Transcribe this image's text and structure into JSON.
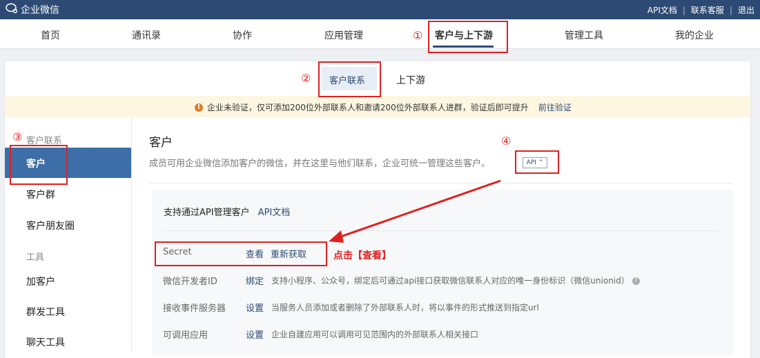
{
  "topbar": {
    "brand": "企业微信",
    "links": [
      "API文档",
      "联系客服",
      "退出"
    ]
  },
  "nav": {
    "items": [
      "首页",
      "通讯录",
      "协作",
      "应用管理",
      "客户与上下游",
      "管理工具",
      "我的企业"
    ],
    "active": "客户与上下游"
  },
  "subtabs": {
    "items": [
      "客户联系",
      "上下游"
    ],
    "active": "客户联系"
  },
  "notice": {
    "text": "企业未验证，仅可添加200位外部联系人和邀请200位外部联系人进群，验证后即可提升",
    "link": "前往验证"
  },
  "sidebar": {
    "group1": "客户联系",
    "group1_items": [
      "客户",
      "客户群",
      "客户朋友圈"
    ],
    "group2": "工具",
    "group2_items": [
      "加客户",
      "群发工具",
      "聊天工具"
    ],
    "active": "客户"
  },
  "content": {
    "title": "客户",
    "description": "成员可用企业微信添加客户的微信，并在这里与他们联系，企业可统一管理这些客户。",
    "api_badge": "API ⌃"
  },
  "api_panel": {
    "title": "支持通过API管理客户",
    "title_link": "API文档",
    "rows": [
      {
        "label": "Secret",
        "actions": [
          "查看",
          "重新获取"
        ],
        "desc": ""
      },
      {
        "label": "微信开发者ID",
        "actions": [
          "绑定"
        ],
        "desc": "支持小程序、公众号，绑定后可通过api接口获取微信联系人对应的唯一身份标识（微信unionid）"
      },
      {
        "label": "接收事件服务器",
        "actions": [
          "设置"
        ],
        "desc": "当服务人员添加或者删除了外部联系人时，将以事件的形式推送到指定url"
      },
      {
        "label": "可调用应用",
        "actions": [
          "设置"
        ],
        "desc": "企业自建应用可以调用可见范围内的外部联系人相关接口"
      }
    ]
  },
  "annotations": {
    "markers": [
      "①",
      "②",
      "③",
      "④"
    ],
    "click_note": "点击【查看】",
    "color": "#e02020"
  }
}
